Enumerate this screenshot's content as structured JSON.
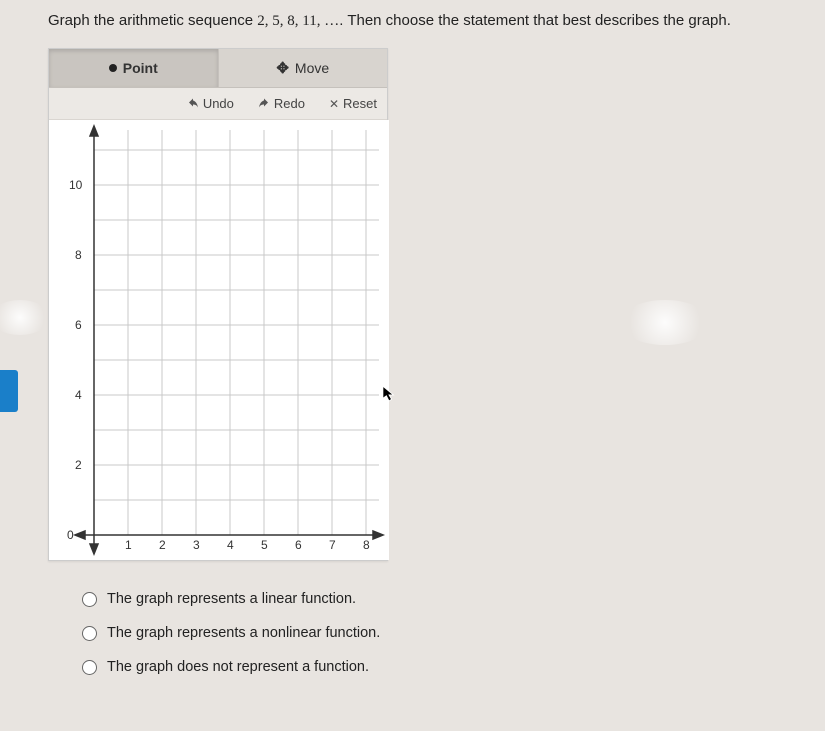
{
  "question": {
    "prefix": "Graph the arithmetic sequence ",
    "sequence": "2, 5, 8, 11, …",
    "suffix": ". Then choose the statement that best describes the graph."
  },
  "tools": {
    "point": "Point",
    "move": "Move"
  },
  "actions": {
    "undo": "Undo",
    "redo": "Redo",
    "reset": "Reset"
  },
  "chart_data": {
    "type": "scatter",
    "title": "",
    "xlabel": "",
    "ylabel": "",
    "xlim": [
      0,
      8
    ],
    "ylim": [
      0,
      11
    ],
    "x_ticks": [
      0,
      1,
      2,
      3,
      4,
      5,
      6,
      7,
      8
    ],
    "y_ticks": [
      2,
      4,
      6,
      8,
      10
    ],
    "grid": true,
    "series": [
      {
        "name": "plotted_points",
        "x": [],
        "y": []
      }
    ],
    "sequence_values": [
      2,
      5,
      8,
      11
    ]
  },
  "options": {
    "a": "The graph represents a linear function.",
    "b": "The graph represents a nonlinear function.",
    "c": "The graph does not represent a function."
  }
}
